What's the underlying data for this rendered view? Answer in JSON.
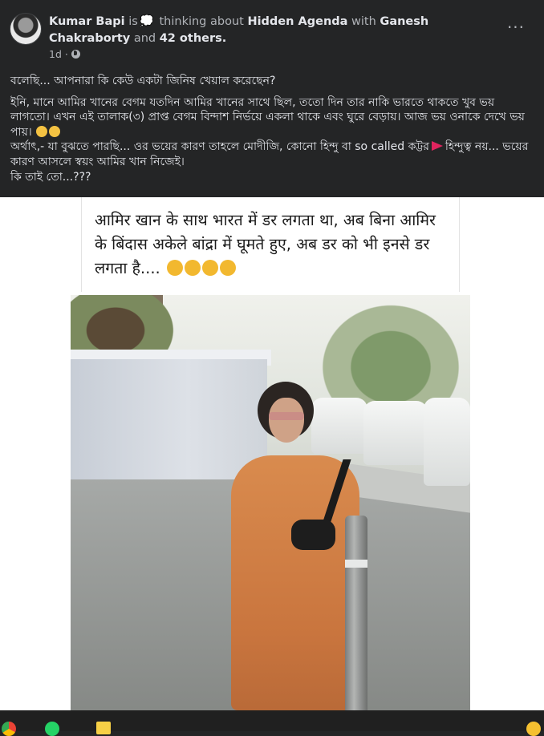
{
  "post": {
    "author": "Kumar Bapi",
    "is_text": "is",
    "activity_text": "thinking about",
    "topic": "Hidden Agenda",
    "with_text": "with",
    "tagged_person": "Ganesh Chakraborty",
    "and_text": "and",
    "others": "42 others.",
    "time": "1d",
    "more_menu": "···",
    "icons": {
      "activity": "thought-bubble-icon",
      "audience": "globe-icon"
    },
    "body": {
      "line1": "বলেছি... আপনারা কি কেউ একটা জিনিষ খেয়াল করেছেন?",
      "line2": "ইনি, মানে আমির খানের বেগম যতদিন আমির খানের সাথে ছিল, ততো দিন তার নাকি ভারতে থাকতে খুব ভয় লাগতো। এখন এই তালাক(৩) প্রাপ্ত বেগম বিন্দাশ নির্ভয়ে একলা থাকে এবং ঘুরে বেড়ায়। আজ ভয় ওনাকে দেখে ভয় পায়।",
      "line3_a": "অর্থাৎ,- যা বুঝতে পারছি... ওর ভয়ের কারণ তাহলে মোদীজি, কোনো হিন্দু বা so called কট্টর",
      "line3_b": "হিন্দুত্ব নয়... ভয়ের কারণ আসলে স্বয়ং আমির খান নিজেই।",
      "line4": "কি তাই তো...???"
    }
  },
  "image": {
    "caption": "आमिर खान के साथ भारत में डर लगता था, अब बिना आमिर के बिंदास अकेले बांद्रा में घूमते हुए, अब डर को भी इनसे डर लगता है...."
  },
  "taskbar": {
    "icons": [
      "chrome-icon",
      "whatsapp-icon",
      "sticky-notes-icon",
      "emoji-icon"
    ]
  },
  "colors": {
    "background": "#242526",
    "text_primary": "#e4e6eb",
    "text_secondary": "#b0b3b8"
  }
}
